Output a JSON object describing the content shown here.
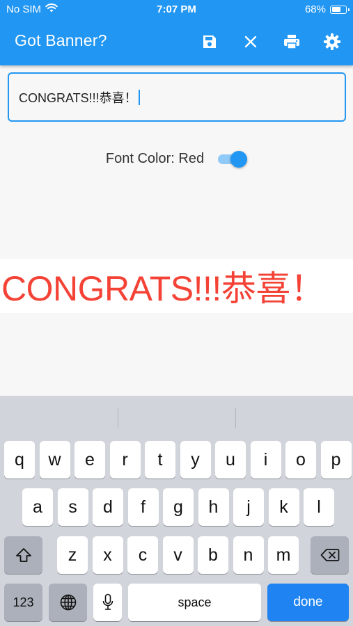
{
  "status_bar": {
    "carrier": "No SIM",
    "time": "7:07 PM",
    "battery_percent": "68%",
    "battery_level": 0.68
  },
  "app_bar": {
    "title": "Got Banner?",
    "actions": [
      {
        "name": "save-icon",
        "label": "save"
      },
      {
        "name": "close-icon",
        "label": "clear"
      },
      {
        "name": "print-icon",
        "label": "print"
      },
      {
        "name": "settings-gear-icon",
        "label": "settings"
      }
    ]
  },
  "colors": {
    "primary": "#2196f3",
    "banner_text": "#f44336",
    "keyboard_bg": "#d1d4da",
    "done_key": "#1f84f2"
  },
  "input": {
    "value": "CONGRATS!!!恭喜！"
  },
  "font_color_toggle": {
    "label": "Font Color: Red",
    "on": true
  },
  "banner": {
    "text": "CONGRATS!!!恭喜！"
  },
  "keyboard": {
    "row1": [
      "q",
      "w",
      "e",
      "r",
      "t",
      "y",
      "u",
      "i",
      "o",
      "p"
    ],
    "row2": [
      "a",
      "s",
      "d",
      "f",
      "g",
      "h",
      "j",
      "k",
      "l"
    ],
    "row3": [
      "z",
      "x",
      "c",
      "v",
      "b",
      "n",
      "m"
    ],
    "numbers_key": "123",
    "space_key": "space",
    "done_key": "done"
  }
}
